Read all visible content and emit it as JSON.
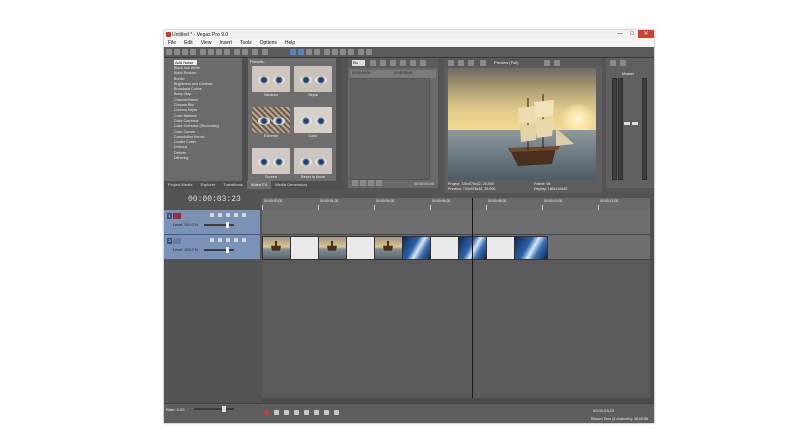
{
  "window": {
    "title": "Untitled * - Vegas Pro 9.0",
    "buttons": [
      "—",
      "□",
      "✕"
    ]
  },
  "menu": [
    "File",
    "Edit",
    "View",
    "Insert",
    "Tools",
    "Options",
    "Help"
  ],
  "fx_list": {
    "selected": "Add Noise",
    "items": [
      "Black and White",
      "Black Restore",
      "Border",
      "Brightness and Contrast",
      "Broadcast Colors",
      "Bump Map",
      "Channel Blend",
      "Chroma Blur",
      "Chroma Keyer",
      "Color Balance",
      "Color Corrector",
      "Color Corrector (Secondary)",
      "Color Curves",
      "Convolution Kernel",
      "Cookie Cutter",
      "Defocus",
      "Deform",
      "Dithering"
    ]
  },
  "presets": {
    "label": "Presets:",
    "thumbs": [
      {
        "caption": "Medium"
      },
      {
        "caption": "Sepia"
      },
      {
        "caption": "Extreme"
      },
      {
        "caption": "Color"
      },
      {
        "caption": "Screen"
      },
      {
        "caption": "Reset to None"
      }
    ]
  },
  "tabs": [
    "Project Media",
    "Explorer",
    "Transitions",
    "Video FX",
    "Media Generators"
  ],
  "active_tab": "Video FX",
  "trimmer": {
    "dropdown": "Bu",
    "ruler_start": "00:00:00;00",
    "ruler_end": "00:00:05;00",
    "time": "00:00:00;00"
  },
  "preview": {
    "mode": "Preview (Full)",
    "project": "Project:  720x576x32, 25.000",
    "preview_res": "Preview:  720x576x32, 25.000",
    "frame": "Frame:    98",
    "display": "Display:  180x144x32"
  },
  "master": {
    "label": "Master"
  },
  "timeline": {
    "timecode": "00:00:03:23",
    "ticks": [
      "00:00:00;00",
      "00:00:01;00",
      "00:00:04;00",
      "00:00:06;00",
      "00:00:08;00",
      "00:00:10;00",
      "00:00:12;00"
    ]
  },
  "tracks": [
    {
      "number": "1",
      "level": "Level: 100.0 %"
    },
    {
      "number": "2",
      "level": "Level: 100.0 %"
    }
  ],
  "bottom": {
    "rate": "Rate: 0.00",
    "time": "00:00:03;23",
    "status": "Record Time (2 channels): 38:05:55"
  }
}
